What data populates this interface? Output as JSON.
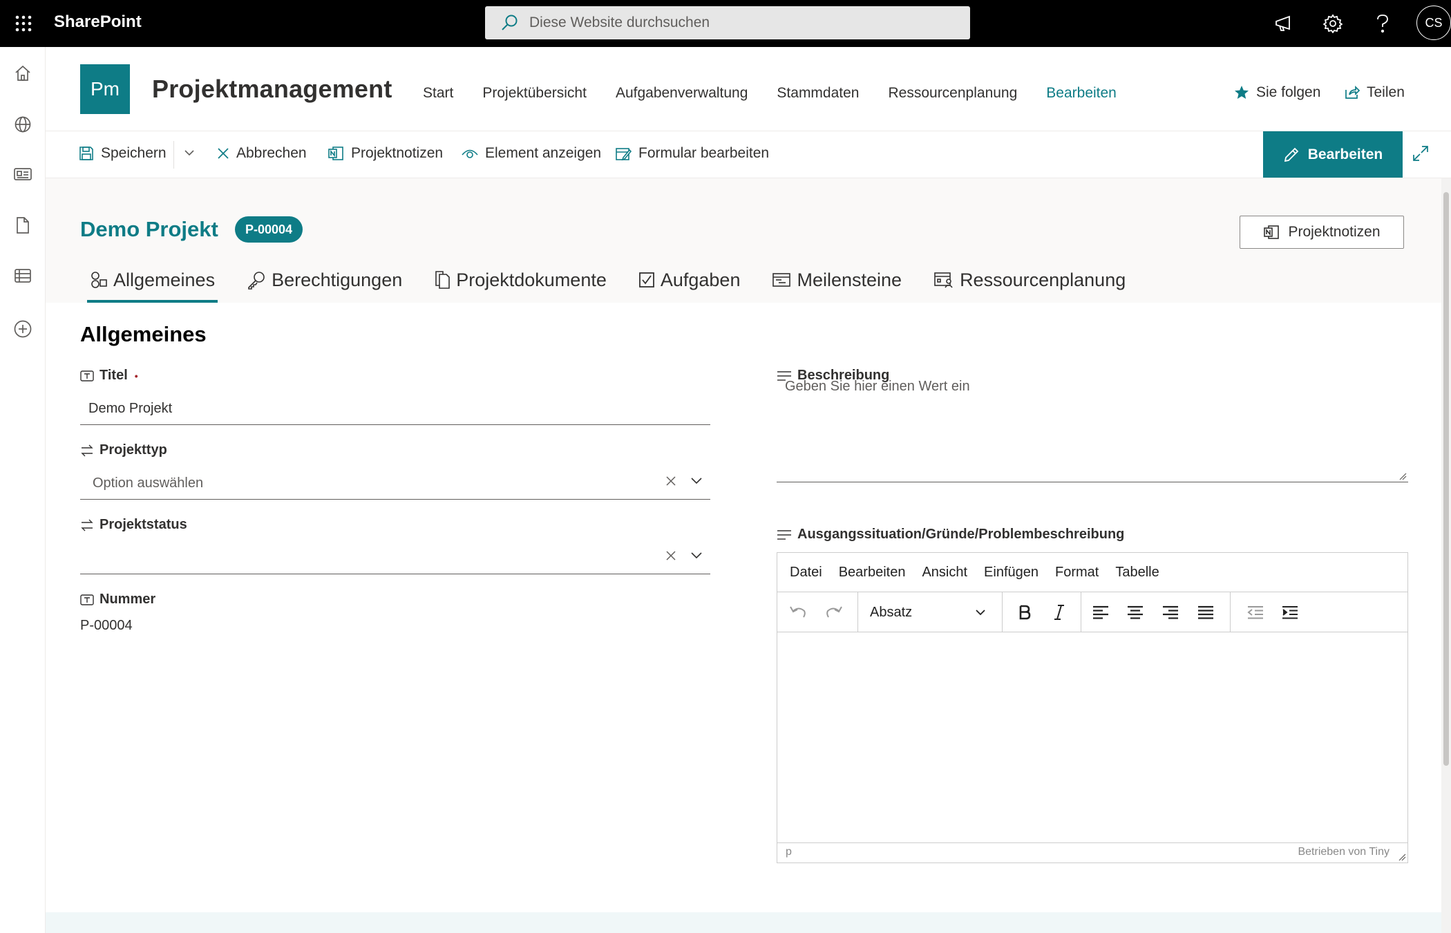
{
  "suite": {
    "brand": "SharePoint",
    "search_placeholder": "Diese Website durchsuchen",
    "user_initials": "CS"
  },
  "site": {
    "logo_text": "Pm",
    "title": "Projektmanagement",
    "nav": [
      {
        "label": "Start"
      },
      {
        "label": "Projektübersicht"
      },
      {
        "label": "Aufgabenverwaltung"
      },
      {
        "label": "Stammdaten"
      },
      {
        "label": "Ressourcenplanung"
      },
      {
        "label": "Bearbeiten"
      }
    ],
    "follow_label": "Sie folgen",
    "share_label": "Teilen"
  },
  "commands": {
    "save": "Speichern",
    "cancel": "Abbrechen",
    "notes": "Projektnotizen",
    "view_item": "Element anzeigen",
    "edit_form": "Formular bearbeiten",
    "edit_button": "Bearbeiten"
  },
  "form": {
    "project_title": "Demo Projekt",
    "project_badge": "P-00004",
    "notes_button": "Projektnotizen",
    "tabs": [
      {
        "label": "Allgemeines"
      },
      {
        "label": "Berechtigungen"
      },
      {
        "label": "Projektdokumente"
      },
      {
        "label": "Aufgaben"
      },
      {
        "label": "Meilensteine"
      },
      {
        "label": "Ressourcenplanung"
      }
    ],
    "section_title": "Allgemeines",
    "fields": {
      "title": {
        "label": "Titel",
        "value": "Demo Projekt",
        "required_mark": "•"
      },
      "project_type": {
        "label": "Projekttyp",
        "placeholder": "Option auswählen"
      },
      "project_status": {
        "label": "Projektstatus",
        "value": ""
      },
      "number": {
        "label": "Nummer",
        "value": "P-00004"
      },
      "description": {
        "label": "Beschreibung",
        "placeholder": "Geben Sie hier einen Wert ein"
      },
      "situation": {
        "label": "Ausgangssituation/Gründe/Problembeschreibung"
      }
    },
    "editor": {
      "menu": [
        "Datei",
        "Bearbeiten",
        "Ansicht",
        "Einfügen",
        "Format",
        "Tabelle"
      ],
      "block_format": "Absatz",
      "status_path": "p",
      "powered_by": "Betrieben von Tiny"
    }
  },
  "colors": {
    "accent": "#0e7c86",
    "suitebar": "#000000"
  }
}
